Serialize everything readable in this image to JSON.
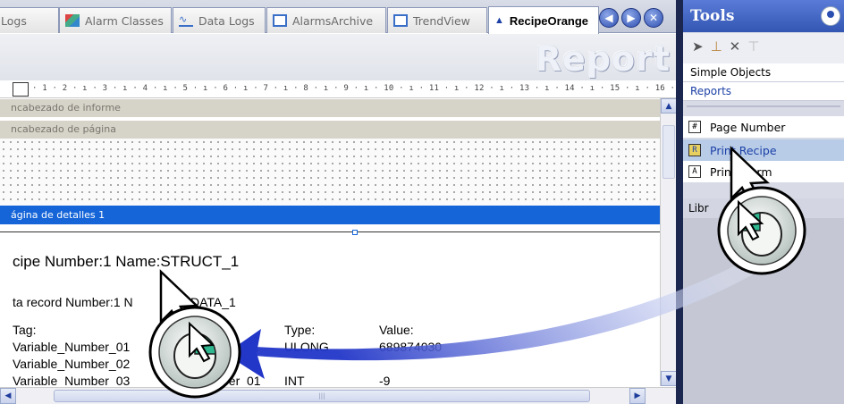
{
  "tabs": [
    {
      "label": "Logs",
      "icon": "log-icon"
    },
    {
      "label": "Alarm Classes",
      "icon": "alarm-classes-icon"
    },
    {
      "label": "Data Logs",
      "icon": "data-logs-icon"
    },
    {
      "label": "AlarmsArchive",
      "icon": "screen-icon"
    },
    {
      "label": "TrendView",
      "icon": "screen-icon"
    },
    {
      "label": "RecipeOrange",
      "icon": "report-icon",
      "active": true
    }
  ],
  "banner": {
    "title": "Report"
  },
  "ruler": {
    "text": "· 1 · 2 · ı · 3 · ı · 4 · ı · 5 · ı · 6 · ı · 7 · ı · 8 · ı · 9 · ı · 10 · ı · 11 · ı · 12 · ı · 13 · ı · 14 · ı · 15 · ı · 16 · ı · 17"
  },
  "sections": {
    "report_header": "ncabezado de informe",
    "page_header": "ncabezado de página",
    "detail": "ágina de detalles 1"
  },
  "report_body": {
    "recipe_line": "cipe Number:1 Name:STRUCT_1",
    "record_line": "ta record Number:1 N",
    "record_line_tail": "DATA_1",
    "tag_header": "Tag:",
    "type_header": "Type:",
    "value_header": "Value:",
    "rows": [
      {
        "tag": "Variable_Number_01",
        "mid": "01",
        "type": "ULONG",
        "value": "689874030"
      },
      {
        "tag": "Variable_Number_02",
        "mid": "",
        "type": "",
        "value": ""
      },
      {
        "tag": "Variable_Number_03",
        "mid": "ber_01",
        "type": "INT",
        "value": "-9"
      }
    ]
  },
  "tools": {
    "title": "Tools",
    "categories": [
      "Simple Objects",
      "Reports"
    ],
    "items": [
      {
        "label": "Page Number",
        "icon": "#"
      },
      {
        "label": "Print Recipe",
        "icon": "R",
        "selected": true
      },
      {
        "label": "Print Alarm",
        "icon": "A"
      }
    ],
    "library_label": "Libr"
  },
  "colors": {
    "accent": "#1565d8",
    "arrow": "#2a3fc8",
    "tools_header": "#3356b4"
  }
}
